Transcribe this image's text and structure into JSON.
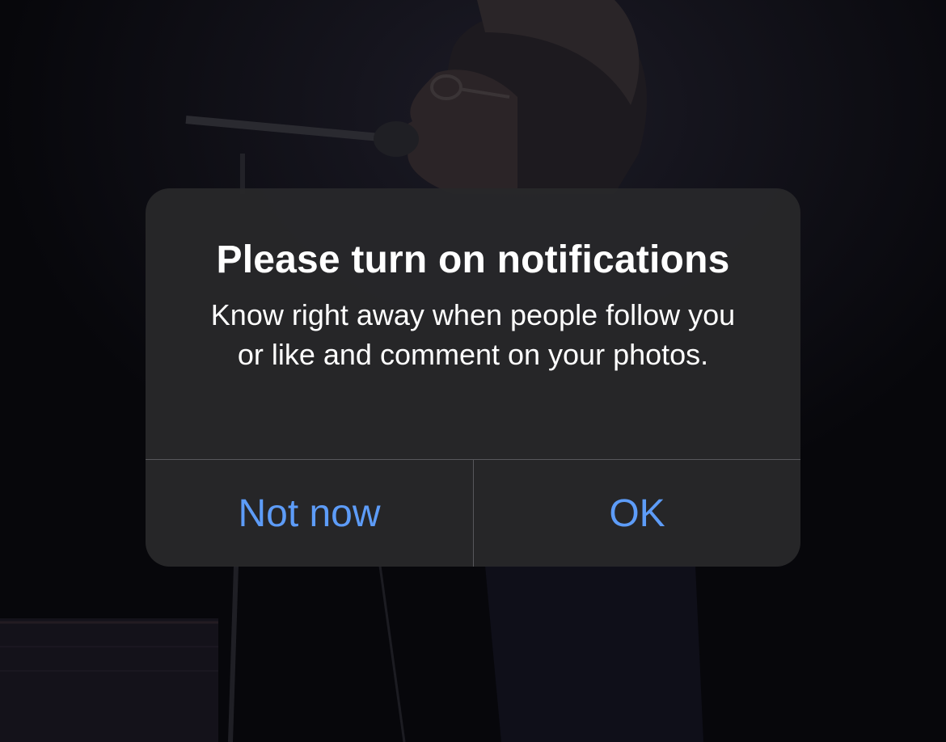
{
  "colors": {
    "alert_background": "#28282a",
    "button_text": "#5d9cf8",
    "title_text": "#ffffff",
    "divider": "#57575b",
    "screen_background": "#0b0b10"
  },
  "alert": {
    "title": "Please turn on notifications",
    "message": "Know right away when people follow you or like and comment on your photos.",
    "buttons": {
      "secondary_label": "Not now",
      "primary_label": "OK"
    }
  }
}
